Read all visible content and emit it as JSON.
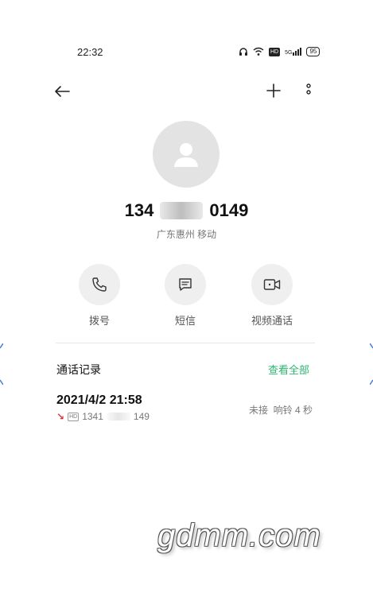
{
  "status_bar": {
    "time": "22:32",
    "hd_label": "HD",
    "network": "5G",
    "battery": "95"
  },
  "contact": {
    "number_prefix": "134",
    "number_suffix": "0149",
    "location": "广东惠州 移动"
  },
  "actions": [
    {
      "label": "拨号",
      "icon": "phone-icon"
    },
    {
      "label": "短信",
      "icon": "message-icon"
    },
    {
      "label": "视频通话",
      "icon": "video-call-icon"
    }
  ],
  "call_log": {
    "title": "通话记录",
    "view_all": "查看全部",
    "entries": [
      {
        "datetime": "2021/4/2 21:58",
        "direction": "missed",
        "hd_label": "HD",
        "number_prefix": "1341",
        "number_suffix": "149",
        "status": "未接  响铃 4 秒"
      }
    ]
  },
  "colors": {
    "accent": "#2bb673",
    "missed": "#e0323c"
  },
  "watermark": "gdmm.com"
}
